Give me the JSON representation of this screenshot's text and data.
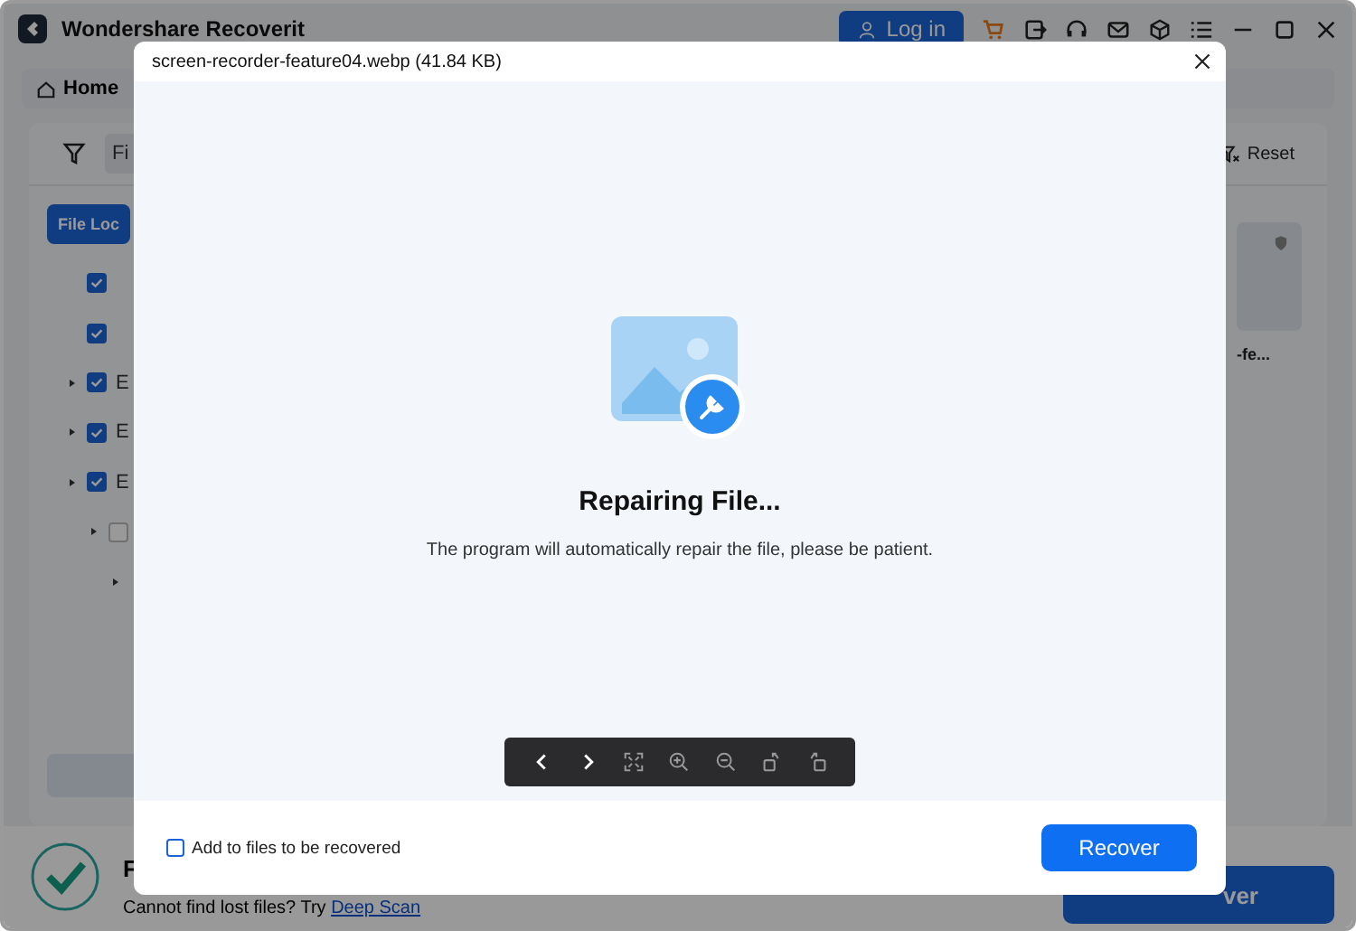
{
  "window": {
    "title": "Wondershare Recoverit",
    "login": "Log in"
  },
  "nav": {
    "home": "Home"
  },
  "filter": {
    "field_value": "Fi",
    "reset": "Reset"
  },
  "sidebar": {
    "tab": "File Loc",
    "tree": [
      {
        "kind": "leaf",
        "checked": true
      },
      {
        "kind": "leaf",
        "checked": true
      },
      {
        "kind": "folder",
        "checked": true,
        "expanded": false,
        "label": "E"
      },
      {
        "kind": "folder",
        "checked": true,
        "expanded": false,
        "label": "E"
      },
      {
        "kind": "folder",
        "checked": true,
        "expanded": false,
        "label": "E",
        "children": [
          {
            "kind": "folder",
            "checked": false,
            "expanded": false,
            "children": [
              {
                "kind": "caret",
                "expanded": false
              }
            ]
          }
        ]
      }
    ]
  },
  "file_card": {
    "name": "-fe..."
  },
  "bottom_bar": {
    "status_title": "F",
    "hint": "Cannot find lost files? Try",
    "link": "Deep Scan",
    "button": "ver"
  },
  "dialog": {
    "title": "screen-recorder-feature04.webp (41.84 KB)",
    "heading": "Repairing File...",
    "message": "The program will automatically repair the file, please be patient.",
    "add_checkbox": {
      "label": "Add to files to be recovered",
      "checked": false
    },
    "recover": "Recover"
  }
}
